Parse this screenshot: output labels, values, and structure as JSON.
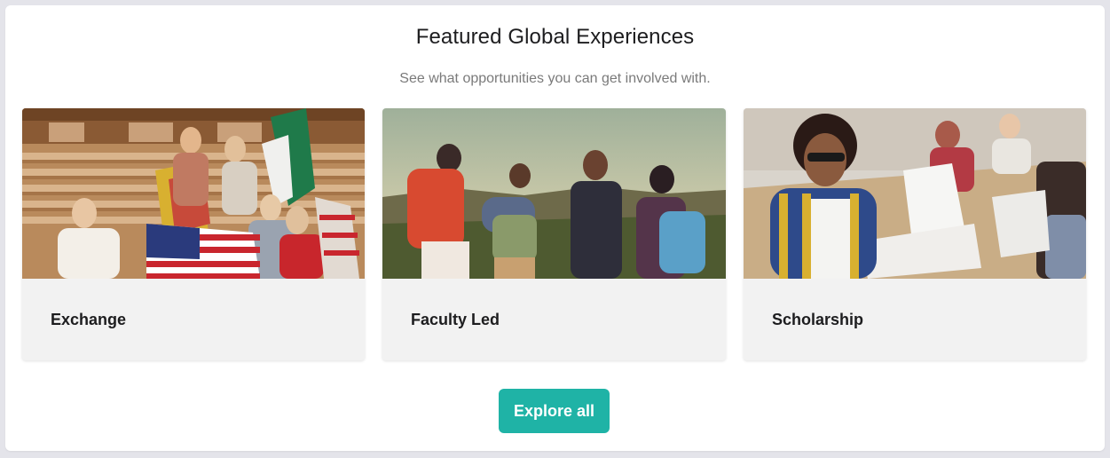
{
  "section": {
    "title": "Featured Global Experiences",
    "subtitle": "See what opportunities you can get involved with."
  },
  "cards": [
    {
      "label": "Exchange"
    },
    {
      "label": "Faculty Led"
    },
    {
      "label": "Scholarship"
    }
  ],
  "explore_button": {
    "label": "Explore all"
  },
  "colors": {
    "accent": "#1fb3a6",
    "page_background": "#e4e4ea",
    "panel_background": "#ffffff",
    "card_background": "#f2f2f2",
    "title_text": "#1d1d1f",
    "subtitle_text": "#7a7a7a"
  }
}
